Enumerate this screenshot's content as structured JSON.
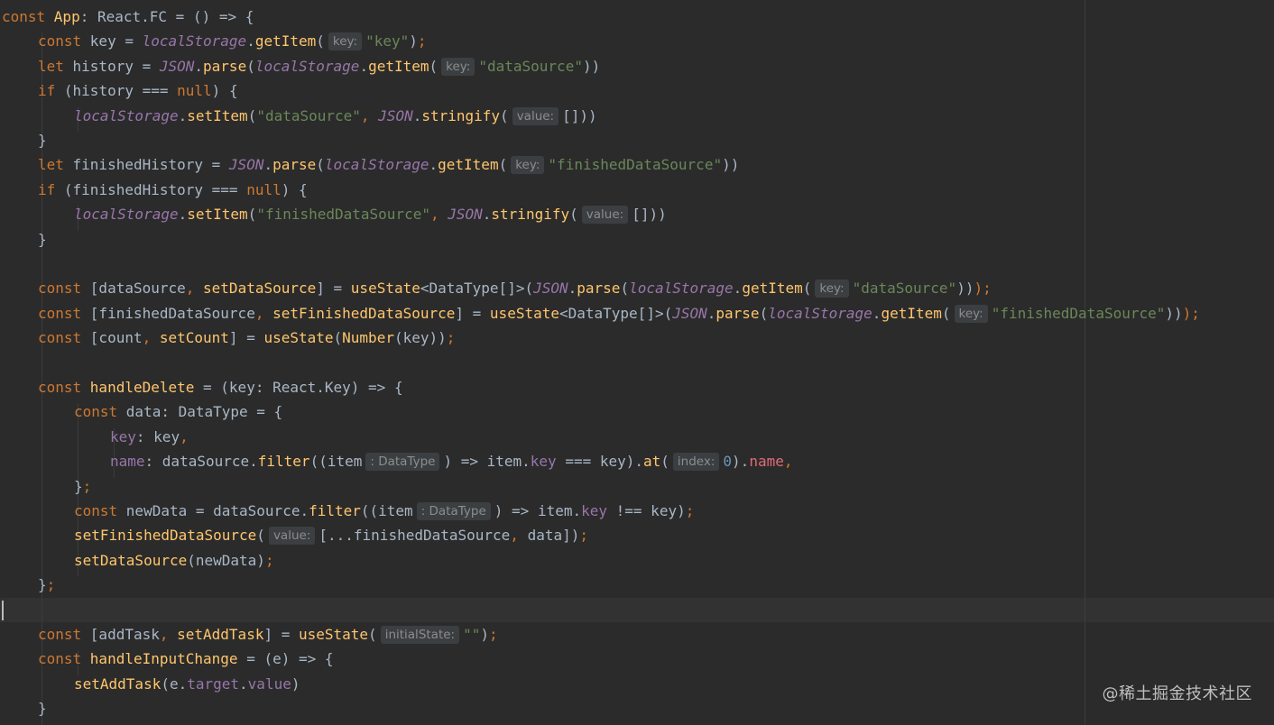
{
  "editor": {
    "language": "typescript-react",
    "theme": "darcula",
    "colors": {
      "background": "#2b2b2b",
      "keyword": "#cc7832",
      "identifier": "#a9b7c6",
      "function": "#ffc66d",
      "string": "#6a8759",
      "number": "#6897bb",
      "property": "#9876aa",
      "hint_background": "#3b3f41",
      "hint_text": "#8c8c8c"
    },
    "lines": [
      {
        "indent": 0,
        "tokens": [
          {
            "t": "kw",
            "v": "const "
          },
          {
            "t": "fn",
            "v": "App"
          },
          {
            "t": "id",
            "v": ": React.FC = () => {"
          }
        ]
      },
      {
        "indent": 1,
        "tokens": [
          {
            "t": "kw",
            "v": "const "
          },
          {
            "t": "id",
            "v": "key = "
          },
          {
            "t": "glob",
            "v": "localStorage"
          },
          {
            "t": "id",
            "v": "."
          },
          {
            "t": "fn",
            "v": "getItem"
          },
          {
            "t": "id",
            "v": "("
          },
          {
            "t": "hint",
            "v": "key:"
          },
          {
            "t": "str",
            "v": "\"key\""
          },
          {
            "t": "id",
            "v": ")"
          },
          {
            "t": "kw",
            "v": ";"
          }
        ]
      },
      {
        "indent": 1,
        "tokens": [
          {
            "t": "kw",
            "v": "let "
          },
          {
            "t": "id",
            "v": "history = "
          },
          {
            "t": "glob",
            "v": "JSON"
          },
          {
            "t": "id",
            "v": "."
          },
          {
            "t": "fn",
            "v": "parse"
          },
          {
            "t": "id",
            "v": "("
          },
          {
            "t": "glob",
            "v": "localStorage"
          },
          {
            "t": "id",
            "v": "."
          },
          {
            "t": "fn",
            "v": "getItem"
          },
          {
            "t": "id",
            "v": "("
          },
          {
            "t": "hint",
            "v": "key:"
          },
          {
            "t": "str",
            "v": "\"dataSource\""
          },
          {
            "t": "id",
            "v": "))"
          }
        ]
      },
      {
        "indent": 1,
        "tokens": [
          {
            "t": "kw",
            "v": "if "
          },
          {
            "t": "id",
            "v": "(history === "
          },
          {
            "t": "kw",
            "v": "null"
          },
          {
            "t": "id",
            "v": ") {"
          }
        ]
      },
      {
        "indent": 2,
        "tokens": [
          {
            "t": "glob",
            "v": "localStorage"
          },
          {
            "t": "id",
            "v": "."
          },
          {
            "t": "fn",
            "v": "setItem"
          },
          {
            "t": "id",
            "v": "("
          },
          {
            "t": "str",
            "v": "\"dataSource\""
          },
          {
            "t": "kw",
            "v": ", "
          },
          {
            "t": "glob",
            "v": "JSON"
          },
          {
            "t": "id",
            "v": "."
          },
          {
            "t": "fn",
            "v": "stringify"
          },
          {
            "t": "id",
            "v": "("
          },
          {
            "t": "hint",
            "v": "value:"
          },
          {
            "t": "id",
            "v": "[]))"
          }
        ]
      },
      {
        "indent": 1,
        "tokens": [
          {
            "t": "id",
            "v": "}"
          }
        ]
      },
      {
        "indent": 1,
        "tokens": [
          {
            "t": "kw",
            "v": "let "
          },
          {
            "t": "id",
            "v": "finishedHistory = "
          },
          {
            "t": "glob",
            "v": "JSON"
          },
          {
            "t": "id",
            "v": "."
          },
          {
            "t": "fn",
            "v": "parse"
          },
          {
            "t": "id",
            "v": "("
          },
          {
            "t": "glob",
            "v": "localStorage"
          },
          {
            "t": "id",
            "v": "."
          },
          {
            "t": "fn",
            "v": "getItem"
          },
          {
            "t": "id",
            "v": "("
          },
          {
            "t": "hint",
            "v": "key:"
          },
          {
            "t": "str",
            "v": "\"finishedDataSource\""
          },
          {
            "t": "id",
            "v": "))"
          }
        ]
      },
      {
        "indent": 1,
        "tokens": [
          {
            "t": "kw",
            "v": "if "
          },
          {
            "t": "id",
            "v": "(finishedHistory === "
          },
          {
            "t": "kw",
            "v": "null"
          },
          {
            "t": "id",
            "v": ") {"
          }
        ]
      },
      {
        "indent": 2,
        "tokens": [
          {
            "t": "glob",
            "v": "localStorage"
          },
          {
            "t": "id",
            "v": "."
          },
          {
            "t": "fn",
            "v": "setItem"
          },
          {
            "t": "id",
            "v": "("
          },
          {
            "t": "str",
            "v": "\"finishedDataSource\""
          },
          {
            "t": "kw",
            "v": ", "
          },
          {
            "t": "glob",
            "v": "JSON"
          },
          {
            "t": "id",
            "v": "."
          },
          {
            "t": "fn",
            "v": "stringify"
          },
          {
            "t": "id",
            "v": "("
          },
          {
            "t": "hint",
            "v": "value:"
          },
          {
            "t": "id",
            "v": "[]))"
          }
        ]
      },
      {
        "indent": 1,
        "tokens": [
          {
            "t": "id",
            "v": "}"
          }
        ]
      },
      {
        "indent": 0,
        "tokens": []
      },
      {
        "indent": 1,
        "tokens": [
          {
            "t": "kw",
            "v": "const "
          },
          {
            "t": "id",
            "v": "[dataSource"
          },
          {
            "t": "kw",
            "v": ", "
          },
          {
            "t": "fn",
            "v": "setDataSource"
          },
          {
            "t": "id",
            "v": "] = "
          },
          {
            "t": "fn",
            "v": "useState"
          },
          {
            "t": "id",
            "v": "<DataType[]>("
          },
          {
            "t": "glob",
            "v": "JSON"
          },
          {
            "t": "id",
            "v": "."
          },
          {
            "t": "fn",
            "v": "parse"
          },
          {
            "t": "id",
            "v": "("
          },
          {
            "t": "glob",
            "v": "localStorage"
          },
          {
            "t": "id",
            "v": "."
          },
          {
            "t": "fn",
            "v": "getItem"
          },
          {
            "t": "id",
            "v": "("
          },
          {
            "t": "hint",
            "v": "key:"
          },
          {
            "t": "str",
            "v": "\"dataSource\""
          },
          {
            "t": "id",
            "v": "))"
          },
          {
            "t": "kw",
            "v": ");"
          }
        ]
      },
      {
        "indent": 1,
        "tokens": [
          {
            "t": "kw",
            "v": "const "
          },
          {
            "t": "id",
            "v": "[finishedDataSource"
          },
          {
            "t": "kw",
            "v": ", "
          },
          {
            "t": "fn",
            "v": "setFinishedDataSource"
          },
          {
            "t": "id",
            "v": "] = "
          },
          {
            "t": "fn",
            "v": "useState"
          },
          {
            "t": "id",
            "v": "<DataType[]>("
          },
          {
            "t": "glob",
            "v": "JSON"
          },
          {
            "t": "id",
            "v": "."
          },
          {
            "t": "fn",
            "v": "parse"
          },
          {
            "t": "id",
            "v": "("
          },
          {
            "t": "glob",
            "v": "localStorage"
          },
          {
            "t": "id",
            "v": "."
          },
          {
            "t": "fn",
            "v": "getItem"
          },
          {
            "t": "id",
            "v": "("
          },
          {
            "t": "hint",
            "v": "key:"
          },
          {
            "t": "str",
            "v": "\"finishedDataSource\""
          },
          {
            "t": "id",
            "v": "))"
          },
          {
            "t": "kw",
            "v": ");"
          }
        ]
      },
      {
        "indent": 1,
        "tokens": [
          {
            "t": "kw",
            "v": "const "
          },
          {
            "t": "id",
            "v": "[count"
          },
          {
            "t": "kw",
            "v": ", "
          },
          {
            "t": "fn",
            "v": "setCount"
          },
          {
            "t": "id",
            "v": "] = "
          },
          {
            "t": "fn",
            "v": "useState"
          },
          {
            "t": "id",
            "v": "("
          },
          {
            "t": "fn",
            "v": "Number"
          },
          {
            "t": "id",
            "v": "(key))"
          },
          {
            "t": "kw",
            "v": ";"
          }
        ]
      },
      {
        "indent": 0,
        "tokens": []
      },
      {
        "indent": 1,
        "tokens": [
          {
            "t": "kw",
            "v": "const "
          },
          {
            "t": "fn",
            "v": "handleDelete"
          },
          {
            "t": "id",
            "v": " = (key: React.Key) => {"
          }
        ]
      },
      {
        "indent": 2,
        "tokens": [
          {
            "t": "kw",
            "v": "const "
          },
          {
            "t": "id",
            "v": "data: DataType = {"
          }
        ]
      },
      {
        "indent": 3,
        "tokens": [
          {
            "t": "prop",
            "v": "key"
          },
          {
            "t": "id",
            "v": ": key"
          },
          {
            "t": "kw",
            "v": ","
          }
        ]
      },
      {
        "indent": 3,
        "tokens": [
          {
            "t": "prop",
            "v": "name"
          },
          {
            "t": "id",
            "v": ": dataSource."
          },
          {
            "t": "fn",
            "v": "filter"
          },
          {
            "t": "id",
            "v": "((item"
          },
          {
            "t": "hint",
            "v": ": DataType"
          },
          {
            "t": "id",
            "v": ") => item."
          },
          {
            "t": "prop",
            "v": "key"
          },
          {
            "t": "id",
            "v": " === key)."
          },
          {
            "t": "fn",
            "v": "at"
          },
          {
            "t": "id",
            "v": "("
          },
          {
            "t": "hint",
            "v": "index:"
          },
          {
            "t": "num",
            "v": "0"
          },
          {
            "t": "id",
            "v": ")."
          },
          {
            "t": "red",
            "v": "name"
          },
          {
            "t": "kw",
            "v": ","
          }
        ]
      },
      {
        "indent": 2,
        "tokens": [
          {
            "t": "id",
            "v": "}"
          },
          {
            "t": "kw",
            "v": ";"
          }
        ]
      },
      {
        "indent": 2,
        "tokens": [
          {
            "t": "kw",
            "v": "const "
          },
          {
            "t": "id",
            "v": "newData = dataSource."
          },
          {
            "t": "fn",
            "v": "filter"
          },
          {
            "t": "id",
            "v": "((item"
          },
          {
            "t": "hint",
            "v": ": DataType"
          },
          {
            "t": "id",
            "v": ") => item."
          },
          {
            "t": "prop",
            "v": "key"
          },
          {
            "t": "id",
            "v": " !== key)"
          },
          {
            "t": "kw",
            "v": ";"
          }
        ]
      },
      {
        "indent": 2,
        "tokens": [
          {
            "t": "fn",
            "v": "setFinishedDataSource"
          },
          {
            "t": "id",
            "v": "("
          },
          {
            "t": "hint",
            "v": "value:"
          },
          {
            "t": "id",
            "v": "[...finishedDataSource"
          },
          {
            "t": "kw",
            "v": ", "
          },
          {
            "t": "id",
            "v": "data])"
          },
          {
            "t": "kw",
            "v": ";"
          }
        ]
      },
      {
        "indent": 2,
        "tokens": [
          {
            "t": "fn",
            "v": "setDataSource"
          },
          {
            "t": "id",
            "v": "(newData)"
          },
          {
            "t": "kw",
            "v": ";"
          }
        ]
      },
      {
        "indent": 1,
        "tokens": [
          {
            "t": "id",
            "v": "}"
          },
          {
            "t": "kw",
            "v": ";"
          }
        ]
      },
      {
        "indent": 0,
        "tokens": [],
        "current": true
      },
      {
        "indent": 1,
        "tokens": [
          {
            "t": "kw",
            "v": "const "
          },
          {
            "t": "id",
            "v": "[addTask"
          },
          {
            "t": "kw",
            "v": ", "
          },
          {
            "t": "fn",
            "v": "setAddTask"
          },
          {
            "t": "id",
            "v": "] = "
          },
          {
            "t": "fn",
            "v": "useState"
          },
          {
            "t": "id",
            "v": "("
          },
          {
            "t": "hint",
            "v": "initialState:"
          },
          {
            "t": "str",
            "v": "\"\""
          },
          {
            "t": "id",
            "v": ")"
          },
          {
            "t": "kw",
            "v": ";"
          }
        ]
      },
      {
        "indent": 1,
        "tokens": [
          {
            "t": "kw",
            "v": "const "
          },
          {
            "t": "fn",
            "v": "handleInputChange"
          },
          {
            "t": "id",
            "v": " = (e) => {"
          }
        ]
      },
      {
        "indent": 2,
        "tokens": [
          {
            "t": "fn",
            "v": "setAddTask"
          },
          {
            "t": "id",
            "v": "(e."
          },
          {
            "t": "prop",
            "v": "target"
          },
          {
            "t": "id",
            "v": "."
          },
          {
            "t": "prop",
            "v": "value"
          },
          {
            "t": "id",
            "v": ")"
          }
        ]
      },
      {
        "indent": 1,
        "tokens": [
          {
            "t": "id",
            "v": "}"
          }
        ]
      }
    ]
  },
  "watermark": {
    "text": "@稀土掘金技术社区"
  }
}
